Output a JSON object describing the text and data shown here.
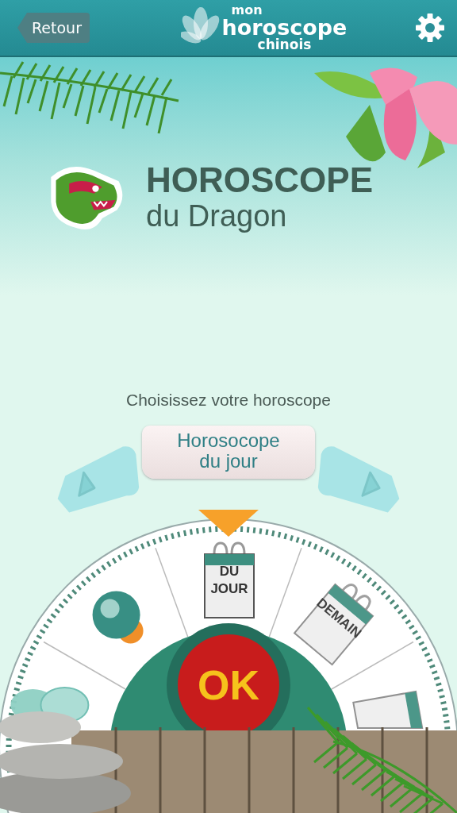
{
  "header": {
    "back_button": "Retour",
    "logo": [
      "mon",
      "horoscope",
      "chinois"
    ]
  },
  "title": {
    "heading": "HOROSCOPE",
    "subheading": "du Dragon"
  },
  "prompt": "Choisissez votre horoscope",
  "selector": {
    "label": "Horosocope du jour"
  },
  "wheel": {
    "segments": [
      {
        "kind": "stones",
        "selected": false
      },
      {
        "kind": "ball",
        "selected": false
      },
      {
        "kind": "calendar",
        "label_lines": [
          "DU",
          "JOUR"
        ],
        "selected": true
      },
      {
        "kind": "calendar",
        "label_lines": [
          "DEMAIN"
        ],
        "selected": false
      },
      {
        "kind": "calendar",
        "selected": false
      }
    ],
    "ok_button": "OK"
  }
}
